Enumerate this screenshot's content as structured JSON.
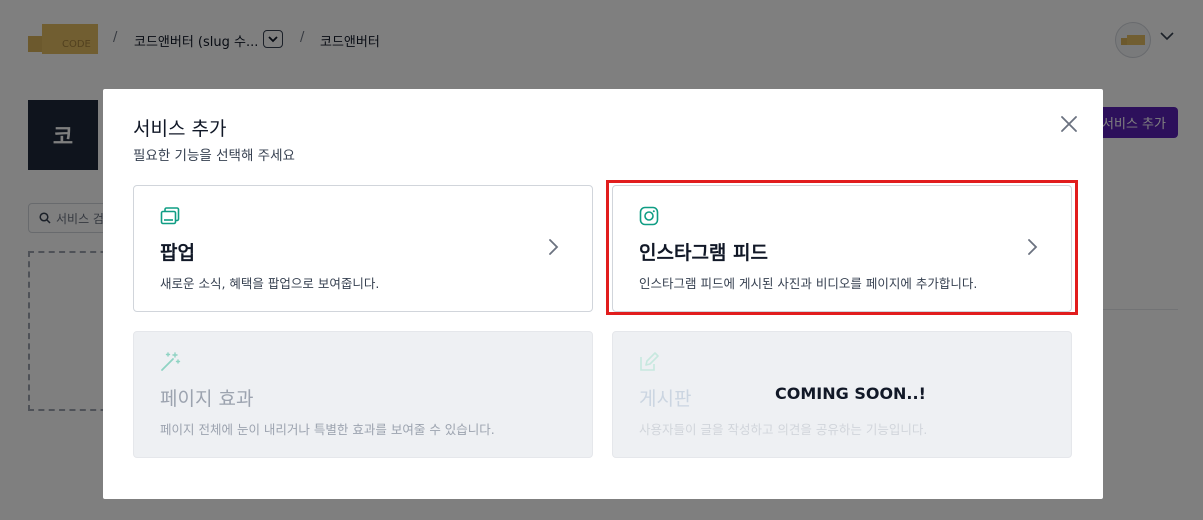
{
  "header": {
    "logo_text": "CODE",
    "breadcrumb_sep": "/",
    "breadcrumb_site": "코드앤버터 (slug 수...",
    "breadcrumb_page": "코드앤버터"
  },
  "background": {
    "site_initial": "코",
    "add_service_label": "서비스 추가",
    "search_placeholder": "서비스 검"
  },
  "modal": {
    "title": "서비스 추가",
    "subtitle": "필요한 기능을 선택해 주세요",
    "cards": [
      {
        "icon": "popup-window-icon",
        "title": "팝업",
        "description": "새로운 소식, 혜택을 팝업으로 보여줍니다."
      },
      {
        "icon": "instagram-icon",
        "title": "인스타그램 피드",
        "description": "인스타그램 피드에 게시된 사진과 비디오를 페이지에 추가합니다."
      },
      {
        "icon": "magic-wand-icon",
        "title": "페이지 효과",
        "description": "페이지 전체에 눈이 내리거나 특별한 효과를 보여줄 수 있습니다."
      },
      {
        "icon": "edit-board-icon",
        "title": "게시판",
        "description": "사용자들이 글을 작성하고 의견을 공유하는 기능입니다.",
        "badge": "COMING SOON..!"
      }
    ]
  },
  "colors": {
    "accent_teal": "#0f9d84",
    "button_purple": "#5b21b6",
    "highlight_red": "#e11d1d"
  }
}
